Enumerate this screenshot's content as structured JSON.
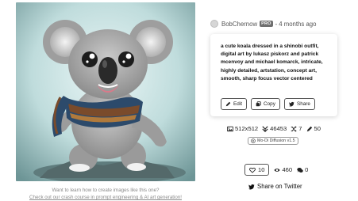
{
  "image": {
    "icon": "koala-artwork"
  },
  "promo": {
    "line1": "Want to learn how to create images like this one?",
    "line2": "Check out our crash course in prompt engineering & AI art generation!"
  },
  "author": {
    "name": "BobChernow",
    "badge": "PRO",
    "separator": "-",
    "time": "4 months ago"
  },
  "prompt": {
    "text": "a cute koala dressed in a shinobi outfit, digital art by lukasz piskorz and patrick mcenvoy and michael komarck, intricate, highly detailed, artstation, concept art, smooth, sharp focus vector centered"
  },
  "actions": {
    "edit": "Edit",
    "copy": "Copy",
    "share": "Share"
  },
  "stats": {
    "resolution": "512x512",
    "remixes": "46453",
    "shares": "7",
    "edits": "50"
  },
  "model": {
    "label": "Mo-Di Diffusion v1.5"
  },
  "social": {
    "likes": "10",
    "views": "460",
    "comments": "0"
  },
  "twitter": {
    "label": "Share on Twitter"
  },
  "colors": {
    "card_border": "#555555",
    "badge": "#6f6f6f",
    "muted_text": "#8a8a8a"
  }
}
